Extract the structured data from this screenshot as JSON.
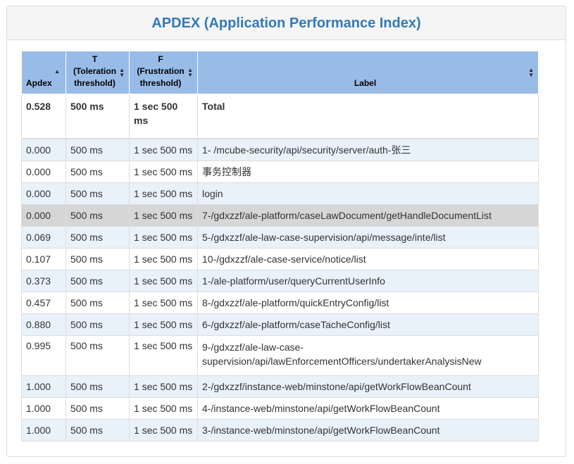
{
  "panel": {
    "title": "APDEX (Application Performance Index)"
  },
  "table": {
    "headers": {
      "apdex": "Apdex",
      "t": "T (Toleration threshold)",
      "f": "F (Frustration threshold)",
      "label": "Label"
    },
    "total": {
      "apdex": "0.528",
      "t": "500 ms",
      "f": "1 sec 500 ms",
      "label": "Total"
    },
    "rows": [
      {
        "apdex": "0.000",
        "t": "500 ms",
        "f": "1 sec 500 ms",
        "label": "1- /mcube-security/api/security/server/auth-张三"
      },
      {
        "apdex": "0.000",
        "t": "500 ms",
        "f": "1 sec 500 ms",
        "label": "事务控制器"
      },
      {
        "apdex": "0.000",
        "t": "500 ms",
        "f": "1 sec 500 ms",
        "label": "login"
      },
      {
        "apdex": "0.000",
        "t": "500 ms",
        "f": "1 sec 500 ms",
        "label": "7-/gdxzzf/ale-platform/caseLawDocument/getHandleDocumentList"
      },
      {
        "apdex": "0.069",
        "t": "500 ms",
        "f": "1 sec 500 ms",
        "label": "5-/gdxzzf/ale-law-case-supervision/api/message/inte/list"
      },
      {
        "apdex": "0.107",
        "t": "500 ms",
        "f": "1 sec 500 ms",
        "label": "10-/gdxzzf/ale-case-service/notice/list"
      },
      {
        "apdex": "0.373",
        "t": "500 ms",
        "f": "1 sec 500 ms",
        "label": "1-/ale-platform/user/queryCurrentUserInfo"
      },
      {
        "apdex": "0.457",
        "t": "500 ms",
        "f": "1 sec 500 ms",
        "label": "8-/gdxzzf/ale-platform/quickEntryConfig/list"
      },
      {
        "apdex": "0.880",
        "t": "500 ms",
        "f": "1 sec 500 ms",
        "label": "6-/gdxzzf/ale-platform/caseTacheConfig/list"
      },
      {
        "apdex": "0.995",
        "t": "500 ms",
        "f": "1 sec 500 ms",
        "label": "9-/gdxzzf/ale-law-case-supervision/api/lawEnforcementOfficers/undertakerAnalysisNew"
      },
      {
        "apdex": "1.000",
        "t": "500 ms",
        "f": "1 sec 500 ms",
        "label": "2-/gdxzzf/instance-web/minstone/api/getWorkFlowBeanCount"
      },
      {
        "apdex": "1.000",
        "t": "500 ms",
        "f": "1 sec 500 ms",
        "label": "4-/instance-web/minstone/api/getWorkFlowBeanCount"
      },
      {
        "apdex": "1.000",
        "t": "500 ms",
        "f": "1 sec 500 ms",
        "label": "3-/instance-web/minstone/api/getWorkFlowBeanCount"
      }
    ],
    "hovered_row": 3
  },
  "colors": {
    "header_bg": "#99bbe8",
    "odd_row": "#e9f1fa",
    "hover_row": "#d6d6d6",
    "title": "#337ab7"
  },
  "icons": {
    "sort_asc": "sort-asc-icon",
    "sort_both": "sort-both-icon"
  }
}
